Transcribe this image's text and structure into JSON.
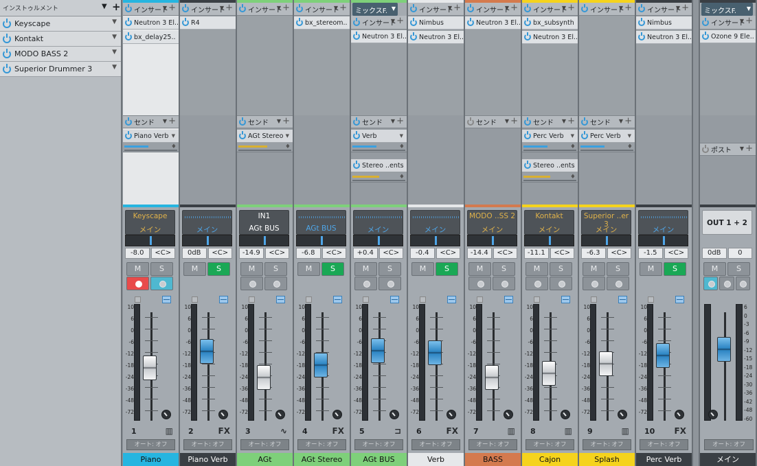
{
  "instruments": {
    "title": "インストゥルメント",
    "items": [
      {
        "label": "Keyscape"
      },
      {
        "label": "Kontakt"
      },
      {
        "label": "MODO BASS 2"
      },
      {
        "label": "Superior Drummer 3"
      }
    ]
  },
  "labels": {
    "insert": "インサート",
    "send": "センド",
    "post": "ポスト",
    "auto": "オート: オフ",
    "mute": "M",
    "solo": "S"
  },
  "channels": [
    {
      "name": "Piano",
      "color": "#26b5e0",
      "number": "1",
      "icon": "keyboard-icon",
      "inserts": [
        "Neutron 3 El..",
        "bx_delay25.."
      ],
      "send": "Piano Verb",
      "sendLevel": 0.5,
      "sendType": "b",
      "input": "Keyscape",
      "output": "メイン",
      "volume": "-8.0",
      "pan": "<C>",
      "solo": false,
      "record": true,
      "monitor": true,
      "faderPos": 0.45,
      "faderColor": "w",
      "light": true
    },
    {
      "name": "Piano Verb",
      "color": "#3a3f44",
      "number": "2",
      "icon": "FX",
      "inserts": [
        "R4"
      ],
      "send": "",
      "input": "",
      "output": "メイン",
      "volume": "0dB",
      "pan": "<C>",
      "solo": true,
      "faderPos": 0.28,
      "faderColor": "b"
    },
    {
      "name": "AGt",
      "color": "#7ed07a",
      "number": "3",
      "icon": "wave-icon",
      "inserts": [],
      "send": "AGt Stereo",
      "sendLevel": 0.6,
      "sendType": "y",
      "input": "IN1",
      "output": "AGt BUS",
      "volume": "-14.9",
      "pan": "<C>",
      "solo": false,
      "faderPos": 0.55,
      "faderColor": "w",
      "inputWhite": true
    },
    {
      "name": "AGt Stereo",
      "color": "#7ed07a",
      "number": "4",
      "icon": "FX",
      "inserts": [
        "bx_stereom.."
      ],
      "send": "",
      "input": "",
      "output": "AGt BUS",
      "volume": "-6.8",
      "pan": "<C>",
      "solo": true,
      "faderPos": 0.42,
      "faderColor": "b",
      "outBlue": true
    },
    {
      "name": "AGt BUS",
      "color": "#7ed07a",
      "number": "5",
      "icon": "bus-icon",
      "mixtab": "ミックスF.",
      "inserts": [
        "Neutron 3 El.."
      ],
      "send": "Verb",
      "sendLevel": 0.5,
      "sendType": "b",
      "send2": "Stereo ..ents",
      "send2Level": 0.55,
      "input": "",
      "output": "メイン",
      "volume": "+0.4",
      "pan": "<C>",
      "solo": false,
      "faderPos": 0.27,
      "faderColor": "b"
    },
    {
      "name": "Verb",
      "color": "#e6e8ea",
      "number": "6",
      "icon": "FX",
      "inserts": [
        "Nimbus",
        "Neutron 3 El.."
      ],
      "send": "",
      "input": "",
      "output": "メイン",
      "volume": "-0.4",
      "pan": "<C>",
      "solo": true,
      "faderPos": 0.29,
      "faderColor": "b"
    },
    {
      "name": "BASS",
      "color": "#d47a4e",
      "number": "7",
      "icon": "keyboard-icon",
      "inserts": [
        "Neutron 3 El.."
      ],
      "send": "",
      "sendOff": true,
      "input": "MODO ..SS 2",
      "output": "メイン",
      "volume": "-14.4",
      "pan": "<C>",
      "solo": false,
      "faderPos": 0.55,
      "faderColor": "w"
    },
    {
      "name": "Cajon",
      "color": "#f5d31d",
      "number": "8",
      "icon": "keyboard-icon",
      "inserts": [
        "bx_subsynth",
        "Neutron 3 El.."
      ],
      "send": "Perc Verb",
      "sendLevel": 0.5,
      "sendType": "b",
      "send2": "Stereo ..ents",
      "send2Level": 0.55,
      "input": "Kontakt",
      "output": "メイン",
      "volume": "-11.1",
      "pan": "<C>",
      "solo": false,
      "faderPos": 0.51,
      "faderColor": "w"
    },
    {
      "name": "Splash",
      "color": "#f5d31d",
      "number": "9",
      "icon": "keyboard-icon",
      "inserts": [],
      "send": "Perc Verb",
      "sendLevel": 0.5,
      "sendType": "b",
      "input": "Superior ..er 3",
      "output": "メイン",
      "volume": "-6.3",
      "pan": "<C>",
      "solo": false,
      "faderPos": 0.41,
      "faderColor": "w"
    },
    {
      "name": "Perc Verb",
      "color": "#3a3f44",
      "number": "10",
      "icon": "FX",
      "inserts": [
        "Nimbus",
        "Neutron 3 El.."
      ],
      "send": "",
      "input": "",
      "output": "メイン",
      "volume": "-1.5",
      "pan": "<C>",
      "solo": true,
      "faderPos": 0.32,
      "faderColor": "b"
    }
  ],
  "main": {
    "name": "メイン",
    "mixtab": "ミックスF.",
    "insert": "Ozone 9 Ele..",
    "output": "OUT 1 + 2",
    "volume": "0dB",
    "pan": "0",
    "faderPos": 0.26
  },
  "scale": [
    "10",
    "6",
    "0",
    "-6",
    "-12",
    "-18",
    "-24",
    "-36",
    "-48",
    "-72"
  ],
  "mainScale": [
    "6",
    "0",
    "-3",
    "-6",
    "-9",
    "-12",
    "-15",
    "-18",
    "-24",
    "-30",
    "-36",
    "-42",
    "-48",
    "-60"
  ]
}
